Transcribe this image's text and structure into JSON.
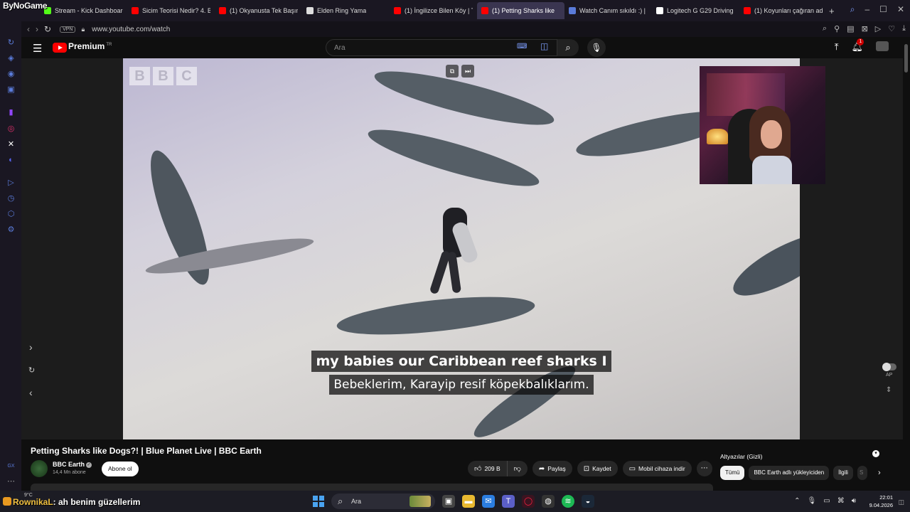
{
  "overlay": {
    "stream_brand": "ByNoGame"
  },
  "browser": {
    "tabs": [
      {
        "title": "Stream - Kick Dashboard",
        "icon": "kick-icon",
        "color": "#53fc18"
      },
      {
        "title": "Sicim Teorisi Nedir? 4. B",
        "icon": "youtube-icon",
        "color": "#ff0000"
      },
      {
        "title": "(1) Okyanusta Tek Başına",
        "icon": "youtube-icon",
        "color": "#ff0000"
      },
      {
        "title": "Elden Ring Yama",
        "icon": "doc-icon",
        "color": "#dddddd"
      },
      {
        "title": "(1) İngilizce Bilen Köy | T",
        "icon": "youtube-icon",
        "color": "#ff0000"
      },
      {
        "title": "(1) Petting Sharks like",
        "icon": "youtube-icon",
        "color": "#ff0000",
        "active": true
      },
      {
        "title": "Watch Canım sıkıldı :) | S",
        "icon": "twitch-icon",
        "color": "#5a7bd9"
      },
      {
        "title": "Logitech G G29 Driving F",
        "icon": "logitech-icon",
        "color": "#ffffff"
      },
      {
        "title": "(1) Koyunları çağıran ada",
        "icon": "youtube-icon",
        "color": "#ff0000"
      }
    ],
    "vpn_label": "VPN",
    "url": "www.youtube.com/watch"
  },
  "youtube": {
    "logo_text": "Premium",
    "logo_sup": "TR",
    "search_placeholder": "Ara",
    "notification_count": "1"
  },
  "video": {
    "watermark": [
      "B",
      "B",
      "C"
    ],
    "subtitle_en": "my babies our Caribbean reef sharks I",
    "subtitle_tr": "Bebeklerim, Karayip resif köpekbalıklarım.",
    "autoplay_label": "AP",
    "title": "Petting Sharks like Dogs?! | Blue Planet Live | BBC Earth",
    "channel": "BBC Earth",
    "subscribers": "14,4 Mn abone",
    "subscribe_label": "Abone ol",
    "likes": "209 B",
    "share_label": "Paylaş",
    "save_label": "Kaydet",
    "download_label": "Mobil cihaza indir"
  },
  "sidebar_panel": {
    "captions_label": "Altyazılar (Gizli)",
    "chips": [
      "Tümü",
      "BBC Earth adlı yükleyiciden",
      "İlgili",
      "S"
    ]
  },
  "taskbar": {
    "weather": "9°C",
    "chat_user": "RownikaL",
    "chat_text": ": ah benim güzellerim",
    "search_label": "Ara",
    "time": "22:01",
    "date": "9.04.2026"
  }
}
